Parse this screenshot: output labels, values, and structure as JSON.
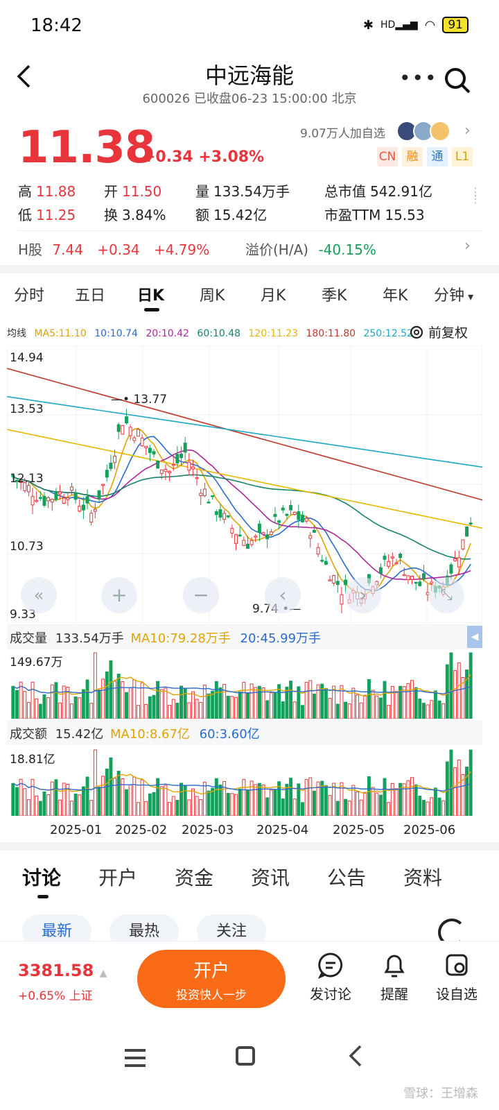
{
  "status": {
    "time": "18:42",
    "battery": "91",
    "signal": "HD"
  },
  "header": {
    "title": "中远海能",
    "subtitle": "600026 已收盘06-23 15:00:00 北京"
  },
  "quote": {
    "price": "11.38",
    "change": "+0.34 +3.08%",
    "followers": "9.07万人加自选",
    "tags": [
      "CN",
      "融",
      "通",
      "L1"
    ]
  },
  "stats": {
    "high_label": "高",
    "high": "11.88",
    "open_label": "开",
    "open": "11.50",
    "vol_label": "量",
    "vol": "133.54万手",
    "mcap_label": "总市值",
    "mcap": "542.91亿",
    "low_label": "低",
    "low": "11.25",
    "turn_label": "换",
    "turn": "3.84%",
    "amt_label": "额",
    "amt": "15.42亿",
    "pe_label": "市盈TTM",
    "pe": "15.53"
  },
  "hshare": {
    "label": "H股",
    "price": "7.44",
    "change": "+0.34",
    "pct": "+4.79%",
    "premium_label": "溢价(H/A)",
    "premium": "-40.15%"
  },
  "ktabs": [
    "分时",
    "五日",
    "日K",
    "周K",
    "月K",
    "季K",
    "年K",
    "分钟"
  ],
  "ma": {
    "label": "均线",
    "ma5": "MA5:11.10",
    "ma10": "10:10.74",
    "ma20": "20:10.42",
    "ma60": "60:10.48",
    "ma120": "120:11.23",
    "ma180": "180:11.80",
    "ma250": "250:12.52",
    "fuquan": "前复权"
  },
  "axis": {
    "y1": "14.94",
    "y2": "13.53",
    "y3": "12.13",
    "y4": "10.73",
    "y5": "9.33",
    "high_mark": "13.77",
    "low_mark": "9.74"
  },
  "volume": {
    "label": "成交量",
    "value": "133.54万手",
    "ma10": "MA10:79.28万手",
    "ma20": "20:45.99万手",
    "max": "149.67万"
  },
  "amount": {
    "label": "成交额",
    "value": "15.42亿",
    "ma10": "MA10:8.67亿",
    "ma60": "60:3.60亿",
    "max": "18.81亿"
  },
  "months": [
    "2025-01",
    "2025-02",
    "2025-03",
    "2025-04",
    "2025-05",
    "2025-06"
  ],
  "lower_tabs": [
    "讨论",
    "开户",
    "资金",
    "资讯",
    "公告",
    "资料"
  ],
  "subtabs": [
    "最新",
    "最热",
    "关注"
  ],
  "bottom": {
    "index_value": "3381.58",
    "index_change": "+0.65% 上证",
    "open_title": "开户",
    "open_sub": "投资快人一步",
    "post": "发讨论",
    "alert": "提醒",
    "watch": "设自选"
  },
  "watermark": "雪球：王增森",
  "colors": {
    "up": "#e8353b",
    "down": "#14a05a",
    "accent": "#f96a17"
  }
}
